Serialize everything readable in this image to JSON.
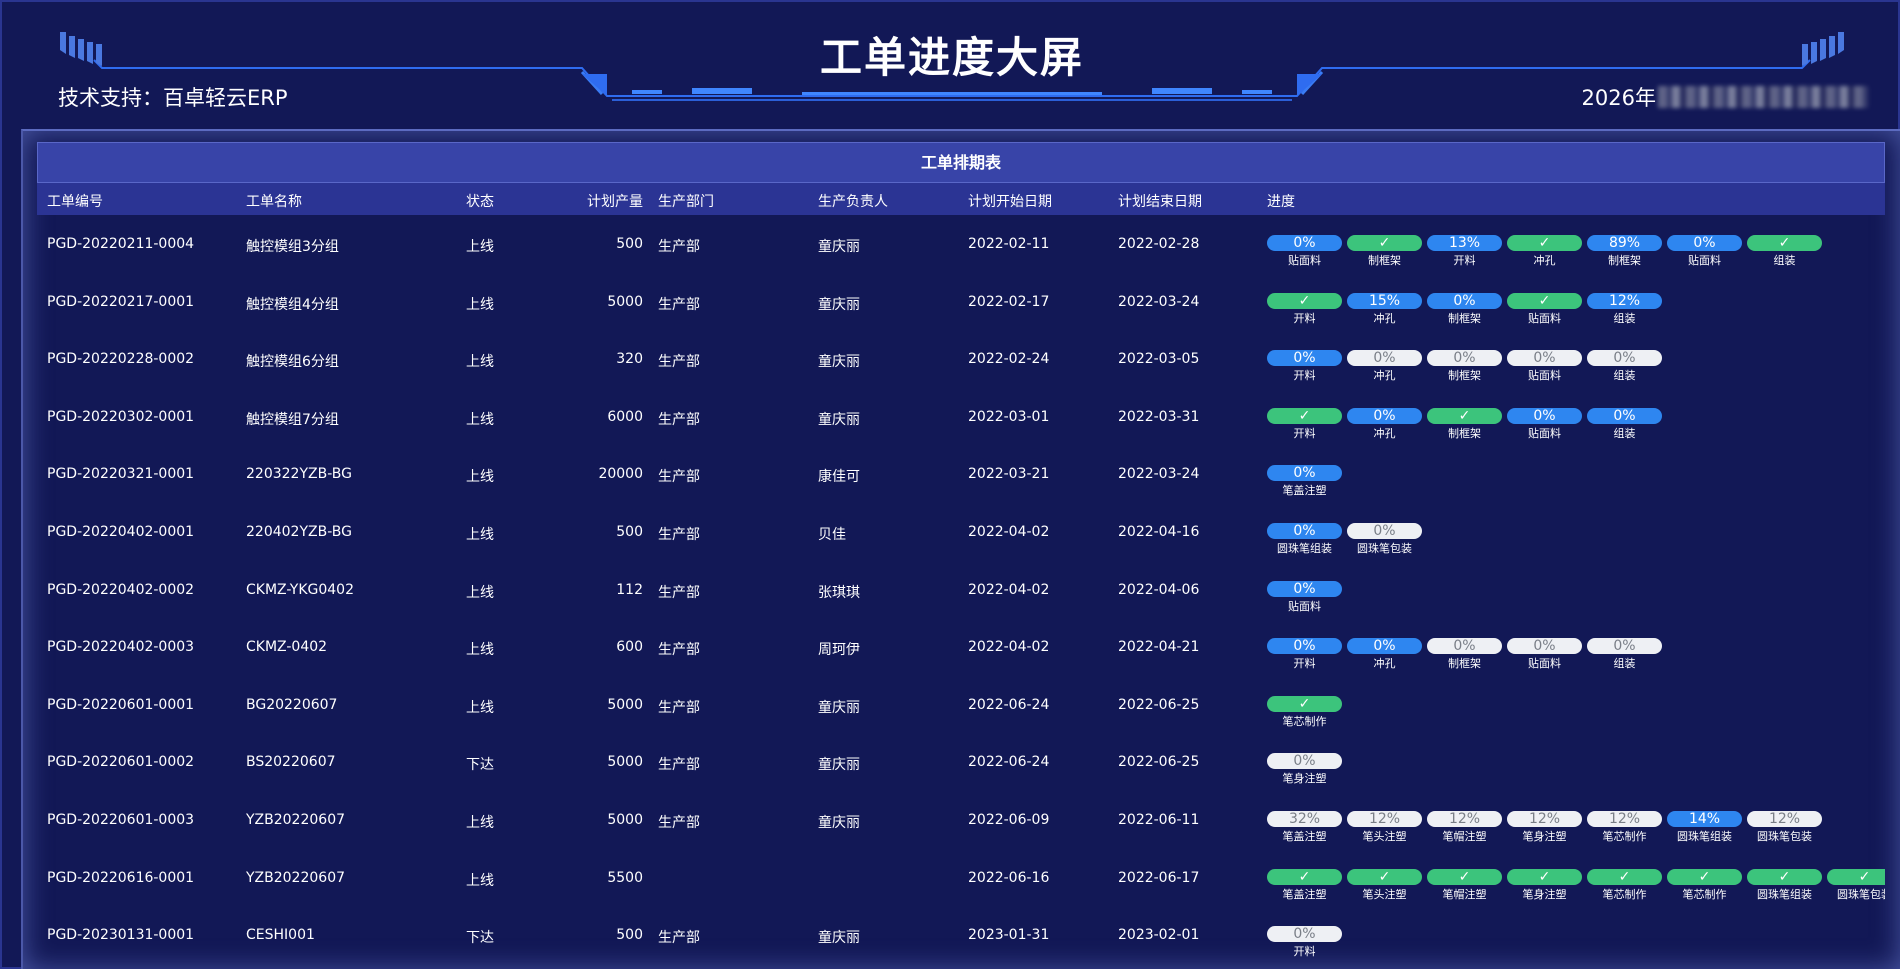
{
  "header": {
    "title": "工单进度大屏",
    "support": "技术支持：百卓轻云ERP",
    "datetime_prefix": "2026年"
  },
  "table": {
    "title": "工单排期表",
    "columns": [
      "工单编号",
      "工单名称",
      "状态",
      "计划产量",
      "生产部门",
      "生产负责人",
      "计划开始日期",
      "计划结束日期",
      "进度"
    ],
    "rows": [
      {
        "no": "PGD-20220211-0004",
        "name": "触控模组3分组",
        "status": "上线",
        "qty": "500",
        "dept": "生产部",
        "owner": "童庆丽",
        "start": "2022-02-11",
        "end": "2022-02-28",
        "steps": [
          {
            "v": "0%",
            "c": "blue",
            "l": "贴面料"
          },
          {
            "v": "✓",
            "c": "green",
            "l": "制框架"
          },
          {
            "v": "13%",
            "c": "blue",
            "l": "开料"
          },
          {
            "v": "✓",
            "c": "green",
            "l": "冲孔"
          },
          {
            "v": "89%",
            "c": "blue",
            "l": "制框架"
          },
          {
            "v": "0%",
            "c": "blue",
            "l": "贴面料"
          },
          {
            "v": "✓",
            "c": "green",
            "l": "组装"
          }
        ]
      },
      {
        "no": "PGD-20220217-0001",
        "name": "触控模组4分组",
        "status": "上线",
        "qty": "5000",
        "dept": "生产部",
        "owner": "童庆丽",
        "start": "2022-02-17",
        "end": "2022-03-24",
        "steps": [
          {
            "v": "✓",
            "c": "green",
            "l": "开料"
          },
          {
            "v": "15%",
            "c": "blue",
            "l": "冲孔"
          },
          {
            "v": "0%",
            "c": "blue",
            "l": "制框架"
          },
          {
            "v": "✓",
            "c": "green",
            "l": "贴面料"
          },
          {
            "v": "12%",
            "c": "blue",
            "l": "组装"
          }
        ]
      },
      {
        "no": "PGD-20220228-0002",
        "name": "触控模组6分组",
        "status": "上线",
        "qty": "320",
        "dept": "生产部",
        "owner": "童庆丽",
        "start": "2022-02-24",
        "end": "2022-03-05",
        "steps": [
          {
            "v": "0%",
            "c": "blue",
            "l": "开料"
          },
          {
            "v": "0%",
            "c": "white",
            "l": "冲孔"
          },
          {
            "v": "0%",
            "c": "white",
            "l": "制框架"
          },
          {
            "v": "0%",
            "c": "white",
            "l": "贴面料"
          },
          {
            "v": "0%",
            "c": "white",
            "l": "组装"
          }
        ]
      },
      {
        "no": "PGD-20220302-0001",
        "name": "触控模组7分组",
        "status": "上线",
        "qty": "6000",
        "dept": "生产部",
        "owner": "童庆丽",
        "start": "2022-03-01",
        "end": "2022-03-31",
        "steps": [
          {
            "v": "✓",
            "c": "green",
            "l": "开料"
          },
          {
            "v": "0%",
            "c": "blue",
            "l": "冲孔"
          },
          {
            "v": "✓",
            "c": "green",
            "l": "制框架"
          },
          {
            "v": "0%",
            "c": "blue",
            "l": "贴面料"
          },
          {
            "v": "0%",
            "c": "blue",
            "l": "组装"
          }
        ]
      },
      {
        "no": "PGD-20220321-0001",
        "name": "220322YZB-BG",
        "status": "上线",
        "qty": "20000",
        "dept": "生产部",
        "owner": "康佳可",
        "start": "2022-03-21",
        "end": "2022-03-24",
        "steps": [
          {
            "v": "0%",
            "c": "blue",
            "l": "笔盖注塑"
          }
        ]
      },
      {
        "no": "PGD-20220402-0001",
        "name": "220402YZB-BG",
        "status": "上线",
        "qty": "500",
        "dept": "生产部",
        "owner": "贝佳",
        "start": "2022-04-02",
        "end": "2022-04-16",
        "steps": [
          {
            "v": "0%",
            "c": "blue",
            "l": "圆珠笔组装"
          },
          {
            "v": "0%",
            "c": "white",
            "l": "圆珠笔包装"
          }
        ]
      },
      {
        "no": "PGD-20220402-0002",
        "name": "CKMZ-YKG0402",
        "status": "上线",
        "qty": "112",
        "dept": "生产部",
        "owner": "张琪琪",
        "start": "2022-04-02",
        "end": "2022-04-06",
        "steps": [
          {
            "v": "0%",
            "c": "blue",
            "l": "贴面料"
          }
        ]
      },
      {
        "no": "PGD-20220402-0003",
        "name": "CKMZ-0402",
        "status": "上线",
        "qty": "600",
        "dept": "生产部",
        "owner": "周珂伊",
        "start": "2022-04-02",
        "end": "2022-04-21",
        "steps": [
          {
            "v": "0%",
            "c": "blue",
            "l": "开料"
          },
          {
            "v": "0%",
            "c": "blue",
            "l": "冲孔"
          },
          {
            "v": "0%",
            "c": "white",
            "l": "制框架"
          },
          {
            "v": "0%",
            "c": "white",
            "l": "贴面料"
          },
          {
            "v": "0%",
            "c": "white",
            "l": "组装"
          }
        ]
      },
      {
        "no": "PGD-20220601-0001",
        "name": "BG20220607",
        "status": "上线",
        "qty": "5000",
        "dept": "生产部",
        "owner": "童庆丽",
        "start": "2022-06-24",
        "end": "2022-06-25",
        "steps": [
          {
            "v": "✓",
            "c": "green",
            "l": "笔芯制作"
          }
        ]
      },
      {
        "no": "PGD-20220601-0002",
        "name": "BS20220607",
        "status": "下达",
        "qty": "5000",
        "dept": "生产部",
        "owner": "童庆丽",
        "start": "2022-06-24",
        "end": "2022-06-25",
        "steps": [
          {
            "v": "0%",
            "c": "white",
            "l": "笔身注塑"
          }
        ]
      },
      {
        "no": "PGD-20220601-0003",
        "name": "YZB20220607",
        "status": "上线",
        "qty": "5000",
        "dept": "生产部",
        "owner": "童庆丽",
        "start": "2022-06-09",
        "end": "2022-06-11",
        "steps": [
          {
            "v": "32%",
            "c": "white",
            "l": "笔盖注塑"
          },
          {
            "v": "12%",
            "c": "white",
            "l": "笔头注塑"
          },
          {
            "v": "12%",
            "c": "white",
            "l": "笔帽注塑"
          },
          {
            "v": "12%",
            "c": "white",
            "l": "笔身注塑"
          },
          {
            "v": "12%",
            "c": "white",
            "l": "笔芯制作"
          },
          {
            "v": "14%",
            "c": "blue",
            "l": "圆珠笔组装"
          },
          {
            "v": "12%",
            "c": "white",
            "l": "圆珠笔包装"
          }
        ]
      },
      {
        "no": "PGD-20220616-0001",
        "name": "YZB20220607",
        "status": "上线",
        "qty": "5500",
        "dept": "",
        "owner": "",
        "start": "2022-06-16",
        "end": "2022-06-17",
        "steps": [
          {
            "v": "✓",
            "c": "green",
            "l": "笔盖注塑"
          },
          {
            "v": "✓",
            "c": "green",
            "l": "笔头注塑"
          },
          {
            "v": "✓",
            "c": "green",
            "l": "笔帽注塑"
          },
          {
            "v": "✓",
            "c": "green",
            "l": "笔身注塑"
          },
          {
            "v": "✓",
            "c": "green",
            "l": "笔芯制作"
          },
          {
            "v": "✓",
            "c": "green",
            "l": "笔芯制作"
          },
          {
            "v": "✓",
            "c": "green",
            "l": "圆珠笔组装"
          },
          {
            "v": "✓",
            "c": "green",
            "l": "圆珠笔包装"
          }
        ]
      },
      {
        "no": "PGD-20230131-0001",
        "name": "CESHI001",
        "status": "下达",
        "qty": "500",
        "dept": "生产部",
        "owner": "童庆丽",
        "start": "2023-01-31",
        "end": "2023-02-01",
        "steps": [
          {
            "v": "0%",
            "c": "white",
            "l": "开料"
          }
        ]
      }
    ]
  },
  "colors": {
    "background": "#121856",
    "table_title_bg": "#3844a8",
    "header_row_bg": "#2b3494",
    "progress_blue": "#2e86f0",
    "progress_green": "#3cc47c",
    "progress_white": "#eef0f4"
  }
}
